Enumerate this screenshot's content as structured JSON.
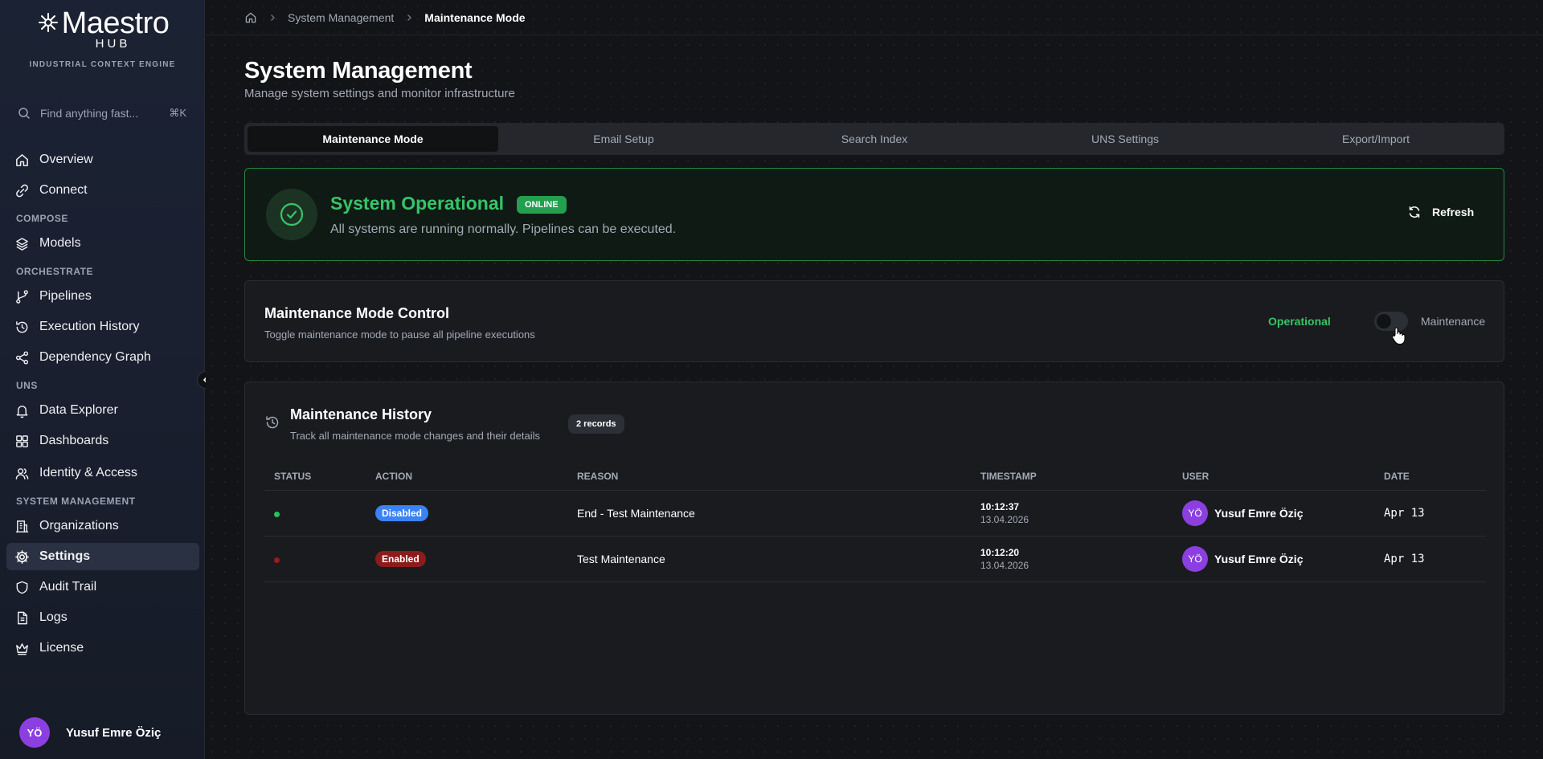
{
  "brand": {
    "name": "Maestro",
    "hub": "HUB",
    "tagline": "INDUSTRIAL CONTEXT ENGINE"
  },
  "search": {
    "placeholder": "Find anything fast...",
    "shortcut": "⌘K"
  },
  "sidebar": {
    "items": [
      {
        "label": "Overview",
        "icon": "home-icon"
      },
      {
        "label": "Connect",
        "icon": "link-icon"
      },
      {
        "section": "COMPOSE"
      },
      {
        "label": "Models",
        "icon": "layers-icon"
      },
      {
        "section": "ORCHESTRATE"
      },
      {
        "label": "Pipelines",
        "icon": "git-branch-icon"
      },
      {
        "label": "Execution History",
        "icon": "history-icon"
      },
      {
        "label": "Dependency Graph",
        "icon": "share-icon"
      },
      {
        "section": "UNS"
      },
      {
        "label": "Data Explorer",
        "icon": "bell-icon"
      },
      {
        "label": "Dashboards",
        "icon": "grid-icon"
      },
      {
        "label": "Identity & Access",
        "icon": "users-icon"
      },
      {
        "section": "SYSTEM MANAGEMENT"
      },
      {
        "label": "Organizations",
        "icon": "building-icon"
      },
      {
        "label": "Settings",
        "icon": "gear-icon",
        "active": true
      },
      {
        "label": "Audit Trail",
        "icon": "shield-icon"
      },
      {
        "label": "Logs",
        "icon": "file-icon"
      },
      {
        "label": "License",
        "icon": "crown-icon"
      }
    ]
  },
  "user": {
    "initials": "YÖ",
    "name": "Yusuf Emre Öziç"
  },
  "breadcrumb": {
    "section": "System Management",
    "current": "Maintenance Mode"
  },
  "page": {
    "title": "System Management",
    "subtitle": "Manage system settings and monitor infrastructure"
  },
  "tabs": [
    {
      "label": "Maintenance Mode",
      "active": true
    },
    {
      "label": "Email Setup"
    },
    {
      "label": "Search Index"
    },
    {
      "label": "UNS Settings"
    },
    {
      "label": "Export/Import"
    }
  ],
  "status": {
    "title": "System Operational",
    "badge": "ONLINE",
    "description": "All systems are running normally. Pipelines can be executed.",
    "refresh_label": "Refresh"
  },
  "control": {
    "title": "Maintenance Mode Control",
    "subtitle": "Toggle maintenance mode to pause all pipeline executions",
    "left_label": "Operational",
    "right_label": "Maintenance",
    "maintenance_on": false
  },
  "history": {
    "title": "Maintenance History",
    "subtitle": "Track all maintenance mode changes and their details",
    "records_badge": "2 records",
    "columns": [
      "STATUS",
      "ACTION",
      "REASON",
      "TIMESTAMP",
      "USER",
      "DATE"
    ],
    "rows": [
      {
        "status_color": "#22c55e",
        "action": "Disabled",
        "action_color": "#3b82f6",
        "reason": "End - Test Maintenance",
        "time": "10:12:37",
        "date_full": "13.04.2026",
        "user_initials": "YÖ",
        "user": "Yusuf Emre Öziç",
        "date": "Apr 13"
      },
      {
        "status_color": "#991b1b",
        "action": "Enabled",
        "action_color": "#8b1c1c",
        "reason": "Test Maintenance",
        "time": "10:12:20",
        "date_full": "13.04.2026",
        "user_initials": "YÖ",
        "user": "Yusuf Emre Öziç",
        "date": "Apr 13"
      }
    ]
  },
  "colors": {
    "accent_green": "#36c468",
    "avatar_purple": "#8b3fe0",
    "sidebar_bg": "#1b2233"
  }
}
